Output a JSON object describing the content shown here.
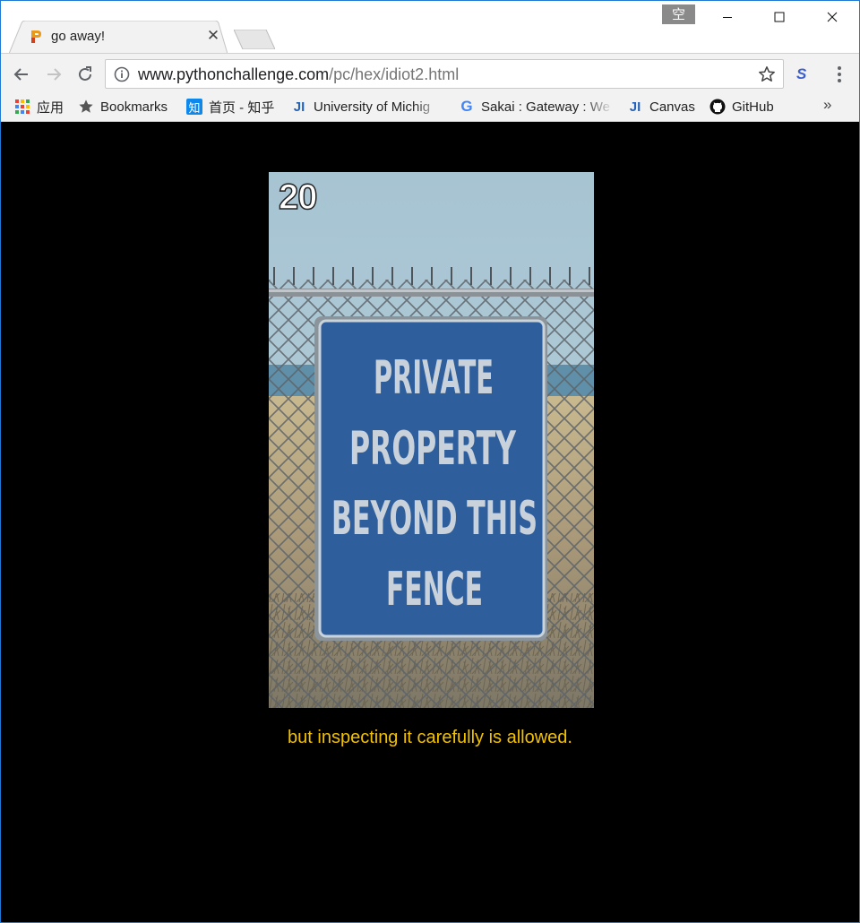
{
  "browser": {
    "tab": {
      "title": "go away!"
    },
    "ime_indicator": "空",
    "address": {
      "domain": "www.pythonchallenge.com",
      "path": "/pc/hex/idiot2.html"
    },
    "extension_label": "S",
    "bookmarks": [
      {
        "label": "应用",
        "icon": "apps-grid-icon"
      },
      {
        "label": "Bookmarks",
        "icon": "star-icon"
      },
      {
        "label": "首页 - 知乎",
        "icon": "zhihu-icon",
        "icon_text": "知"
      },
      {
        "label": "University of Michig",
        "icon": "ji-icon",
        "icon_text": "JI"
      },
      {
        "label": "Sakai : Gateway : We",
        "icon": "google-icon",
        "icon_text": "G"
      },
      {
        "label": "Canvas",
        "icon": "ji-icon",
        "icon_text": "JI"
      },
      {
        "label": "GitHub",
        "icon": "github-icon"
      }
    ],
    "overflow_label": "»"
  },
  "page": {
    "image": {
      "number": "20",
      "sign_lines": [
        "PRIVATE",
        "PROPERTY",
        "BEYOND THIS",
        "FENCE"
      ]
    },
    "caption": "but inspecting it carefully is allowed."
  },
  "colors": {
    "background": "#000000",
    "caption": "#f1c100",
    "sign_blue": "#2f5e9c"
  }
}
